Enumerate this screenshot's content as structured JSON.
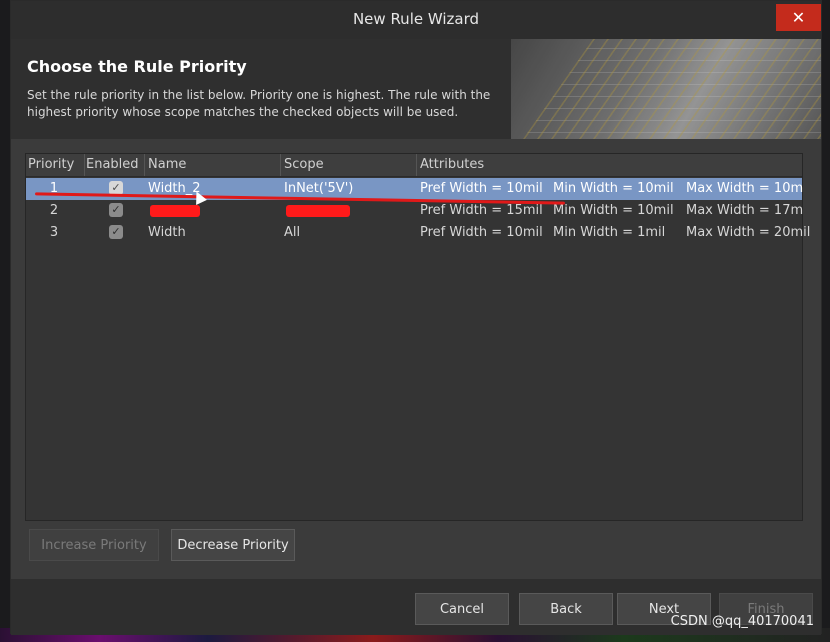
{
  "window": {
    "title": "New Rule Wizard",
    "close_label": "✕"
  },
  "header": {
    "title": "Choose the Rule Priority",
    "description": "Set the rule priority in the list below. Priority one is highest. The rule with the highest priority whose scope matches the checked objects will be used."
  },
  "table": {
    "columns": [
      "Priority",
      "Enabled",
      "Name",
      "Scope",
      "Attributes"
    ],
    "rows": [
      {
        "priority": "1",
        "enabled": "✓",
        "name": "Width_2",
        "scope": "InNet('5V')",
        "pref": "Pref Width = 10mil",
        "min": "Min Width = 10mil",
        "max": "Max Width = 10m"
      },
      {
        "priority": "2",
        "enabled": "✓",
        "name": "",
        "scope": "",
        "pref": "Pref Width = 15mil",
        "min": "Min Width = 10mil",
        "max": "Max Width = 17m"
      },
      {
        "priority": "3",
        "enabled": "✓",
        "name": "Width",
        "scope": "All",
        "pref": "Pref Width = 10mil",
        "min": "Min Width = 1mil",
        "max": "Max Width = 20mil"
      }
    ]
  },
  "buttons": {
    "increase": "Increase Priority",
    "decrease": "Decrease Priority",
    "cancel": "Cancel",
    "back": "Back",
    "next": "Next",
    "finish": "Finish"
  },
  "watermark": "CSDN @qq_40170041",
  "colors": {
    "selected_row": "#7996c4",
    "close": "#c42b1c",
    "annotation_red": "#e01919"
  }
}
